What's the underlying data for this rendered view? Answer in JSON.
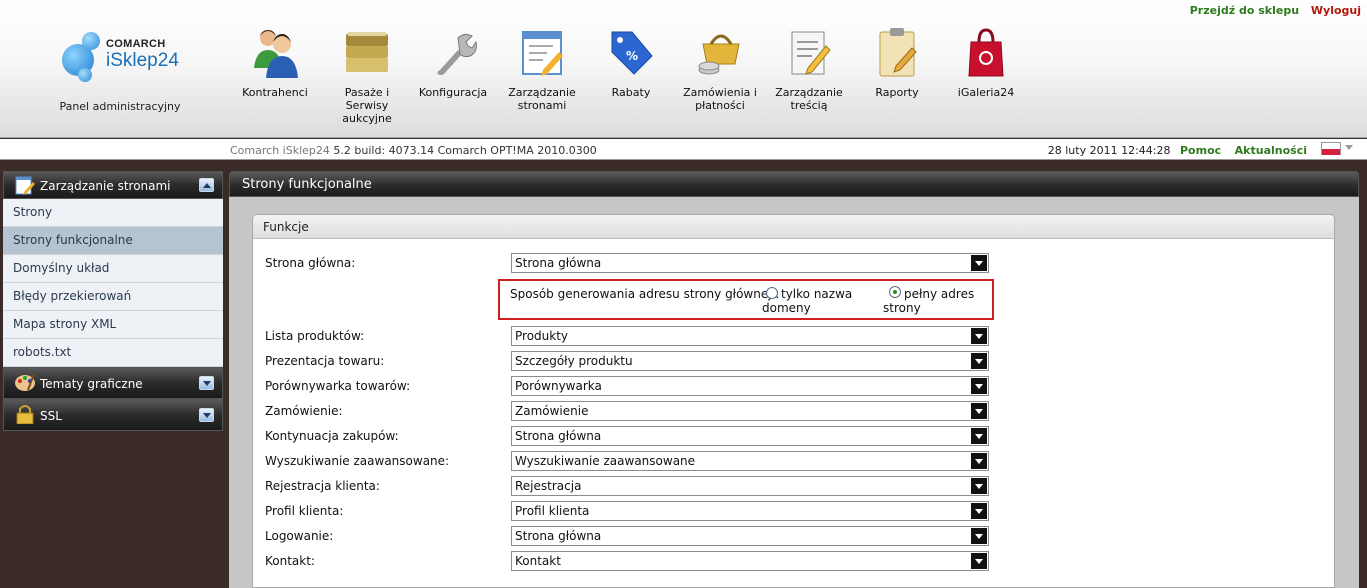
{
  "header": {
    "go_shop": "Przejdź do sklepu",
    "logout": "Wyloguj",
    "logo_top": "COMARCH",
    "logo_main": "iSklep24",
    "panel_label": "Panel administracyjny",
    "nav": [
      {
        "label": "Kontrahenci",
        "icon": "users-icon"
      },
      {
        "label": "Pasaże i Serwisy aukcyjne",
        "icon": "folders-icon"
      },
      {
        "label": "Konfiguracja",
        "icon": "wrench-icon"
      },
      {
        "label": "Zarządzanie stronami",
        "icon": "page-edit-icon"
      },
      {
        "label": "Rabaty",
        "icon": "discount-tag-icon"
      },
      {
        "label": "Zamówienia i płatności",
        "icon": "basket-coins-icon"
      },
      {
        "label": "Zarządzanie treścią",
        "icon": "document-pencil-icon"
      },
      {
        "label": "Raporty",
        "icon": "clipboard-icon"
      },
      {
        "label": "iGaleria24",
        "icon": "shopping-bag-icon"
      }
    ]
  },
  "infobar": {
    "product": "Comarch iSklep24",
    "build": "5.2 build: 4073.14",
    "optima": "Comarch OPT!MA 2010.0300",
    "datetime": "28 luty 2011 12:44:28",
    "help": "Pomoc",
    "news": "Aktualności"
  },
  "sidebar": {
    "sections": [
      {
        "title": "Zarządzanie stronami",
        "expanded": true
      },
      {
        "title": "Tematy graficzne",
        "expanded": false
      },
      {
        "title": "SSL",
        "expanded": false
      }
    ],
    "items": [
      "Strony",
      "Strony funkcjonalne",
      "Domyślny układ",
      "Błędy przekierowań",
      "Mapa strony XML",
      "robots.txt"
    ],
    "active_item": "Strony funkcjonalne"
  },
  "main": {
    "title": "Strony funkcjonalne",
    "fieldset_title": "Funkcje",
    "home_address": {
      "question": "Sposób generowania adresu strony głównej :",
      "option1_line1": "tylko nazwa",
      "option1_line2": "domeny",
      "option2_line1": "pełny adres",
      "option2_line2": "strony",
      "selected": "pełny adres strony"
    },
    "rows": [
      {
        "label": "Strona główna:",
        "value": "Strona główna"
      },
      {
        "label": "Lista produktów:",
        "value": "Produkty"
      },
      {
        "label": "Prezentacja towaru:",
        "value": "Szczegóły produktu"
      },
      {
        "label": "Porównywarka towarów:",
        "value": "Porównywarka"
      },
      {
        "label": "Zamówienie:",
        "value": "Zamówienie"
      },
      {
        "label": "Kontynuacja zakupów:",
        "value": "Strona główna"
      },
      {
        "label": "Wyszukiwanie zaawansowane:",
        "value": "Wyszukiwanie zaawansowane"
      },
      {
        "label": "Rejestracja klienta:",
        "value": "Rejestracja"
      },
      {
        "label": "Profil klienta:",
        "value": "Profil klienta"
      },
      {
        "label": "Logowanie:",
        "value": "Strona główna"
      },
      {
        "label": "Kontakt:",
        "value": "Kontakt"
      }
    ]
  }
}
